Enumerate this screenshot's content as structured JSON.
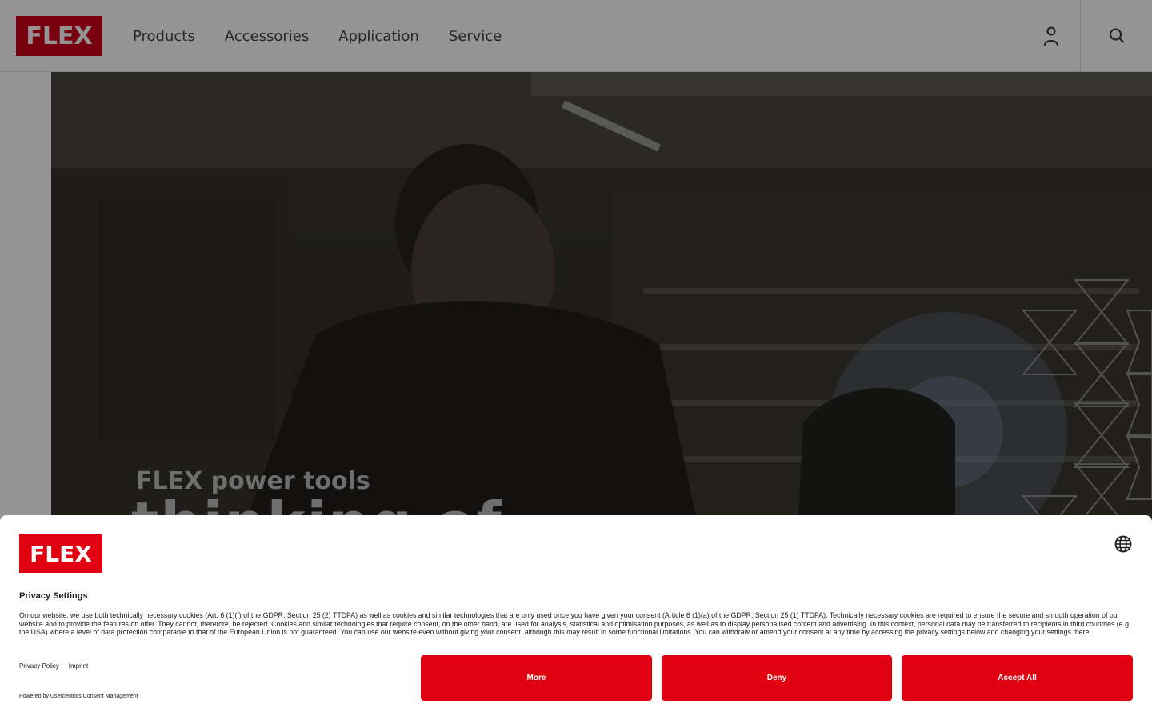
{
  "header": {
    "logo_text": "FLEX",
    "nav": [
      "Products",
      "Accessories",
      "Application",
      "Service"
    ],
    "user_icon": "user-icon",
    "search_icon": "search-icon"
  },
  "hero": {
    "subtitle": "FLEX power tools",
    "headline_partial": "thinking of"
  },
  "consent": {
    "logo_text": "FLEX",
    "language_icon": "globe-icon",
    "title": "Privacy Settings",
    "body": "On our website, we use both technically necessary cookies (Art. 6 (1)(f) of the GDPR, Section 25 (2) TTDPA) as well as cookies and similar technologies that are only used once you have given your consent (Article 6 (1)(a) of the GDPR, Section 25 (1) TTDPA). Technically necessary cookies are required to ensure the secure and smooth operation of our website and to provide the features on offer. They cannot, therefore, be rejected. Cookies and similar technologies that require consent, on the other hand, are used for analysis, statistical and optimisation purposes, as well as to display personalised content and advertising. In this context, personal data may be transferred to recipients in third countries (e.g. the USA) where a level of data protection comparable to that of the European Union is not guaranteed. You can use our website even without giving your consent, although this may result in some functional limitations. You can withdraw or amend your consent at any time by accessing the privacy settings below and changing your settings there.",
    "links": [
      "Privacy Policy",
      "Imprint"
    ],
    "powered_by": "Powered by Usercentrics Consent Management",
    "buttons": {
      "more": "More",
      "deny": "Deny",
      "accept": "Accept All"
    },
    "accent_color": "#e1000f"
  }
}
